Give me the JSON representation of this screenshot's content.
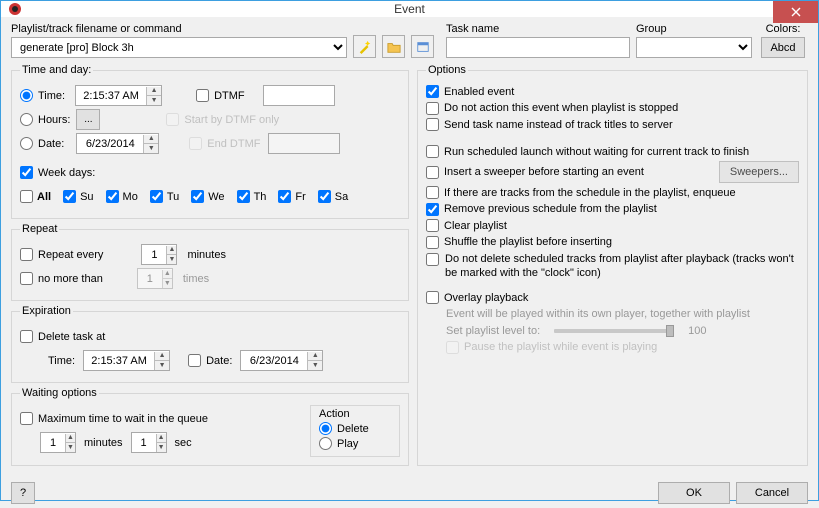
{
  "title": "Event",
  "top": {
    "filename_label": "Playlist/track filename or command",
    "filename_value": "generate [pro] Block 3h",
    "taskname_label": "Task name",
    "taskname_value": "",
    "group_label": "Group",
    "group_value": "",
    "colors_label": "Colors:",
    "colors_btn": "Abcd"
  },
  "time": {
    "legend": "Time and day:",
    "time_label": "Time:",
    "time_value": "2:15:37 AM",
    "hours_label": "Hours:",
    "hours_btn": "...",
    "date_label": "Date:",
    "date_value": "6/23/2014",
    "dtmf_label": "DTMF",
    "dtmf_value": "",
    "start_dtmf_label": "Start by DTMF only",
    "end_dtmf_label": "End DTMF",
    "end_dtmf_value": "",
    "weekdays_label": "Week days:",
    "all_label": "All",
    "days": [
      "Su",
      "Mo",
      "Tu",
      "We",
      "Th",
      "Fr",
      "Sa"
    ]
  },
  "repeat": {
    "legend": "Repeat",
    "every_label": "Repeat every",
    "every_value": "1",
    "every_unit": "minutes",
    "nomore_label": "no more than",
    "nomore_value": "1",
    "nomore_unit": "times"
  },
  "exp": {
    "legend": "Expiration",
    "delete_label": "Delete task at",
    "time_label": "Time:",
    "time_value": "2:15:37 AM",
    "date_label": "Date:",
    "date_value": "6/23/2014"
  },
  "wait": {
    "legend": "Waiting options",
    "max_label": "Maximum time to wait in the queue",
    "min_value": "1",
    "min_unit": "minutes",
    "sec_value": "1",
    "sec_unit": "sec",
    "action_label": "Action",
    "delete_label": "Delete",
    "play_label": "Play"
  },
  "opts": {
    "legend": "Options",
    "enabled": "Enabled event",
    "noaction": "Do not action this event when playlist is stopped",
    "sendtask": "Send task name instead of track titles to server",
    "runsched": "Run scheduled launch without waiting for current track to finish",
    "sweeper": "Insert a sweeper before starting an event",
    "sweepers_btn": "Sweepers...",
    "enqueue": "If there are tracks from the schedule in the playlist, enqueue",
    "removeprev": "Remove previous schedule from the playlist",
    "clear": "Clear playlist",
    "shuffle": "Shuffle the playlist before inserting",
    "nodelete": "Do not delete scheduled tracks from playlist after playback (tracks won't be marked with the \"clock\" icon)",
    "overlay": "Overlay playback",
    "overlay_hint": "Event will be played within its own player, together with playlist",
    "setlevel": "Set playlist level to:",
    "level_value": "100",
    "pause": "Pause the playlist while event is playing"
  },
  "footer": {
    "help": "?",
    "ok": "OK",
    "cancel": "Cancel"
  }
}
